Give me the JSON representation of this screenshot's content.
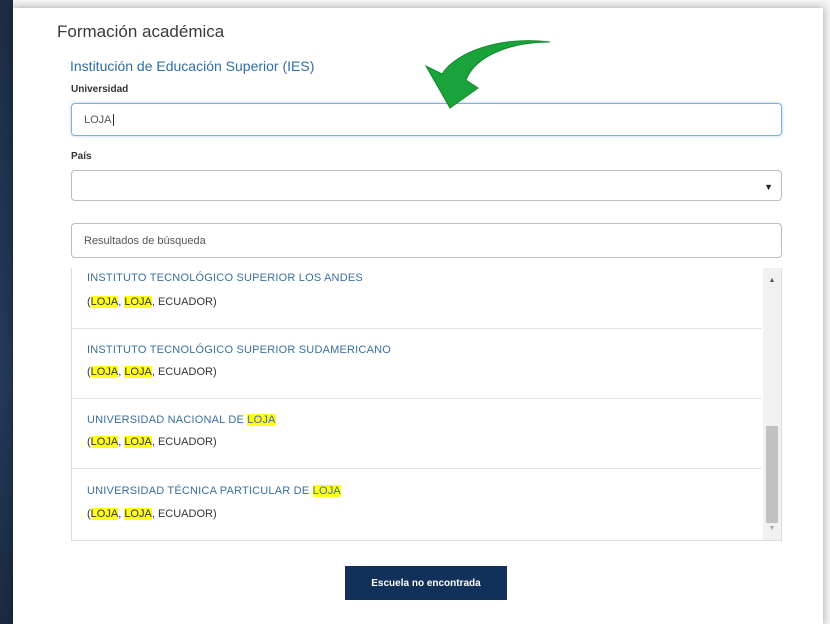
{
  "section_title": "Formación académica",
  "subsection_title": "Institución de Educación Superior (IES)",
  "university": {
    "label": "Universidad",
    "value": "LOJA"
  },
  "country": {
    "label": "País",
    "value": ""
  },
  "search_results_title": "Resultados de búsqueda",
  "results": [
    {
      "name_prefix": "INSTITUTO TECNOLÓGICO SUPERIOR LOS ANDES",
      "name_match": "",
      "loc_open": "(",
      "loc_match1": "LOJA",
      "loc_sep": ", ",
      "loc_match2": "LOJA",
      "loc_rest": ", ECUADOR)"
    },
    {
      "name_prefix": "INSTITUTO TECNOLÓGICO SUPERIOR SUDAMERICANO",
      "name_match": "",
      "loc_open": "(",
      "loc_match1": "LOJA",
      "loc_sep": ", ",
      "loc_match2": "LOJA",
      "loc_rest": ", ECUADOR)"
    },
    {
      "name_prefix": "UNIVERSIDAD NACIONAL DE ",
      "name_match": "LOJA",
      "loc_open": "(",
      "loc_match1": "LOJA",
      "loc_sep": ", ",
      "loc_match2": "LOJA",
      "loc_rest": ", ECUADOR)"
    },
    {
      "name_prefix": "UNIVERSIDAD TÉCNICA PARTICULAR DE ",
      "name_match": "LOJA",
      "loc_open": "(",
      "loc_match1": "LOJA",
      "loc_sep": ", ",
      "loc_match2": "LOJA",
      "loc_rest": ", ECUADOR)"
    }
  ],
  "not_found_button": "Escuela no encontrada",
  "colors": {
    "highlight": "#ffff1a",
    "button_bg": "#12315a",
    "link_blue": "#3b6f9e",
    "arrow_green": "#1aa33a"
  },
  "icons": {
    "select_arrow": "triangle-down",
    "annotation": "green-curved-arrow"
  }
}
